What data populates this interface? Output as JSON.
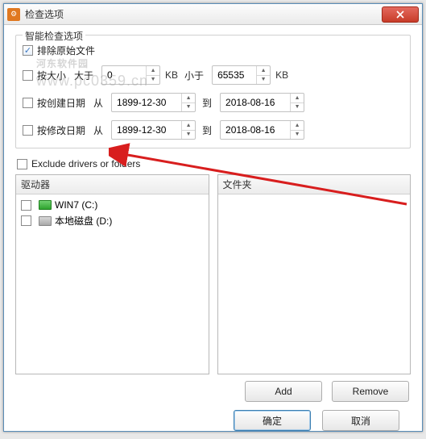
{
  "window": {
    "title": "检查选项"
  },
  "watermark": {
    "brand": "河东软件园",
    "url": "www.pc0359.cn"
  },
  "group": {
    "legend": "智能检查选项"
  },
  "opts": {
    "excludeRaw": {
      "label": "排除原始文件",
      "checked": true
    },
    "bySize": {
      "label": "按大小",
      "checked": false,
      "gt": "大于",
      "lt": "小于",
      "min": "0",
      "max": "65535",
      "unit": "KB"
    },
    "byCreate": {
      "label": "按创建日期",
      "checked": false,
      "from": "从",
      "to": "到",
      "date1": "1899-12-30",
      "date2": "2018-08-16"
    },
    "byModify": {
      "label": "按修改日期",
      "checked": false,
      "from": "从",
      "to": "到",
      "date1": "1899-12-30",
      "date2": "2018-08-16"
    }
  },
  "exclude": {
    "label": "Exclude drivers or folders",
    "checked": false
  },
  "drivers": {
    "header": "驱动器",
    "items": [
      {
        "label": "WIN7 (C:)",
        "checked": false,
        "icon": "c"
      },
      {
        "label": "本地磁盘 (D:)",
        "checked": false,
        "icon": "d"
      }
    ]
  },
  "folders": {
    "header": "文件夹"
  },
  "buttons": {
    "add": "Add",
    "remove": "Remove",
    "ok": "确定",
    "cancel": "取消"
  }
}
